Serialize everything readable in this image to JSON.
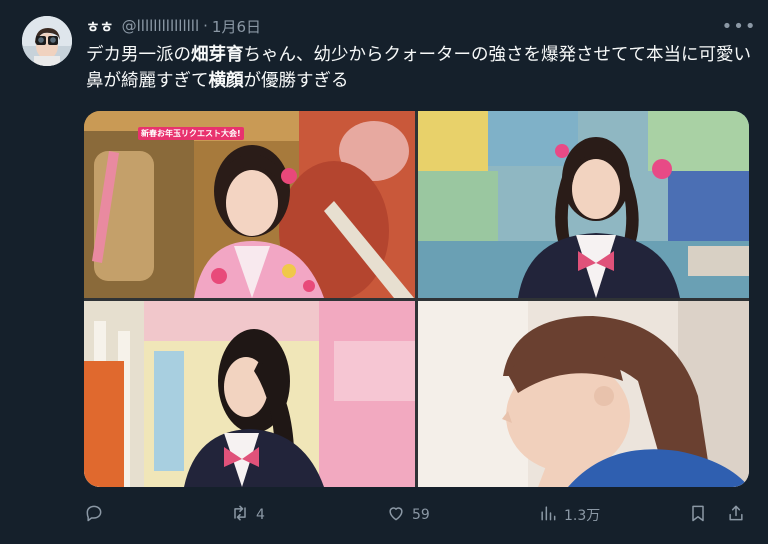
{
  "author": {
    "display_name": "ㅎㅎ",
    "handle": "@lllllllllllllll",
    "separator": "·",
    "date": "1月6日"
  },
  "more_label": "•••",
  "tweet": {
    "part1": "デカ男一派の",
    "bold1": "畑芽育",
    "part2": "ちゃん、幼少からクォーターの強さを爆発させてて本当に可愛い 鼻が綺麗すぎて",
    "bold2": "横顔",
    "part3": "が優勝すぎる"
  },
  "media": {
    "cell1_caption": "新春お年玉リクエスト大会!"
  },
  "actions": {
    "replies": "",
    "retweets": "4",
    "likes": "59",
    "views": "1.3万"
  },
  "colors": {
    "background": "#15202b",
    "text": "#f7f9f9",
    "muted": "#8b98a5"
  },
  "icons": [
    "avatar",
    "more-icon",
    "reply-icon",
    "retweet-icon",
    "like-icon",
    "views-icon",
    "bookmark-icon",
    "share-icon"
  ]
}
